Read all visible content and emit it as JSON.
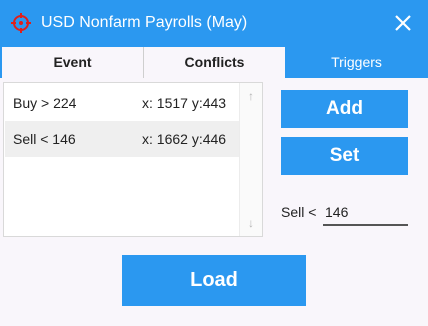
{
  "window": {
    "title": "USD Nonfarm Payrolls (May)",
    "title_icon": "crosshair-icon",
    "close_icon": "close-icon",
    "accent_color": "#2b98f0"
  },
  "tabs": [
    {
      "label": "Event"
    },
    {
      "label": "Conflicts"
    },
    {
      "label": "Triggers",
      "active": true
    }
  ],
  "triggers": {
    "list": [
      {
        "label": "Buy > 224",
        "coord": "x: 1517 y:443"
      },
      {
        "label": "Sell < 146",
        "coord": "x: 1662 y:446"
      }
    ],
    "scroll_up_icon": "arrow-up-icon",
    "scroll_down_icon": "arrow-down-icon",
    "add_label": "Add",
    "set_label": "Set",
    "condition_label": "Sell <",
    "condition_value": "146"
  },
  "footer": {
    "load_label": "Load"
  }
}
